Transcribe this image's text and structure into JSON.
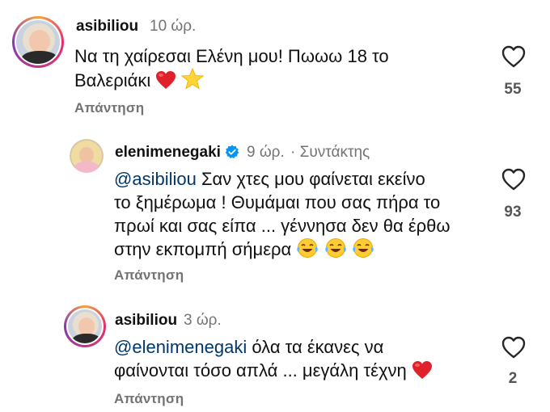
{
  "comments": [
    {
      "username": "asibiliou",
      "time": "10 ώρ.",
      "text_lines": [
        "Να τη χαίρεσαι Ελένη μου! Πωωω 18 το",
        "Βαλεριάκι"
      ],
      "emojis": [
        "red-heart",
        "star"
      ],
      "reply_label": "Απάντηση",
      "likes": "55",
      "avatar_ring": true
    },
    {
      "username": "elenimenegaki",
      "time": "9 ώρ.",
      "role": "· Συντάκτης",
      "mention": "@asibiliou",
      "text_lines": [
        "Σαν χτες μου φαίνεται εκείνο",
        "το ξημέρωμα ! Θυμάμαι που σας πήρα το",
        "πρωί και σας είπα ... γέννησα δεν θα έρθω",
        "στην εκπομπή σήμερα"
      ],
      "emojis": [
        "tears-of-joy",
        "tears-of-joy",
        "tears-of-joy"
      ],
      "reply_label": "Απάντηση",
      "likes": "93",
      "verified": true,
      "avatar_ring": false
    },
    {
      "username": "asibiliou",
      "time": "3 ώρ.",
      "mention": "@elenimenegaki",
      "text_lines": [
        "όλα τα έκανες να",
        "φαίνονται τόσο απλά ... μεγάλη τέχνη"
      ],
      "emojis": [
        "red-heart"
      ],
      "reply_label": "Απάντηση",
      "likes": "2",
      "avatar_ring": true
    }
  ],
  "colors": {
    "text": "#111111",
    "secondary": "#737373",
    "mention": "#00376b",
    "verified": "#0095f6"
  }
}
